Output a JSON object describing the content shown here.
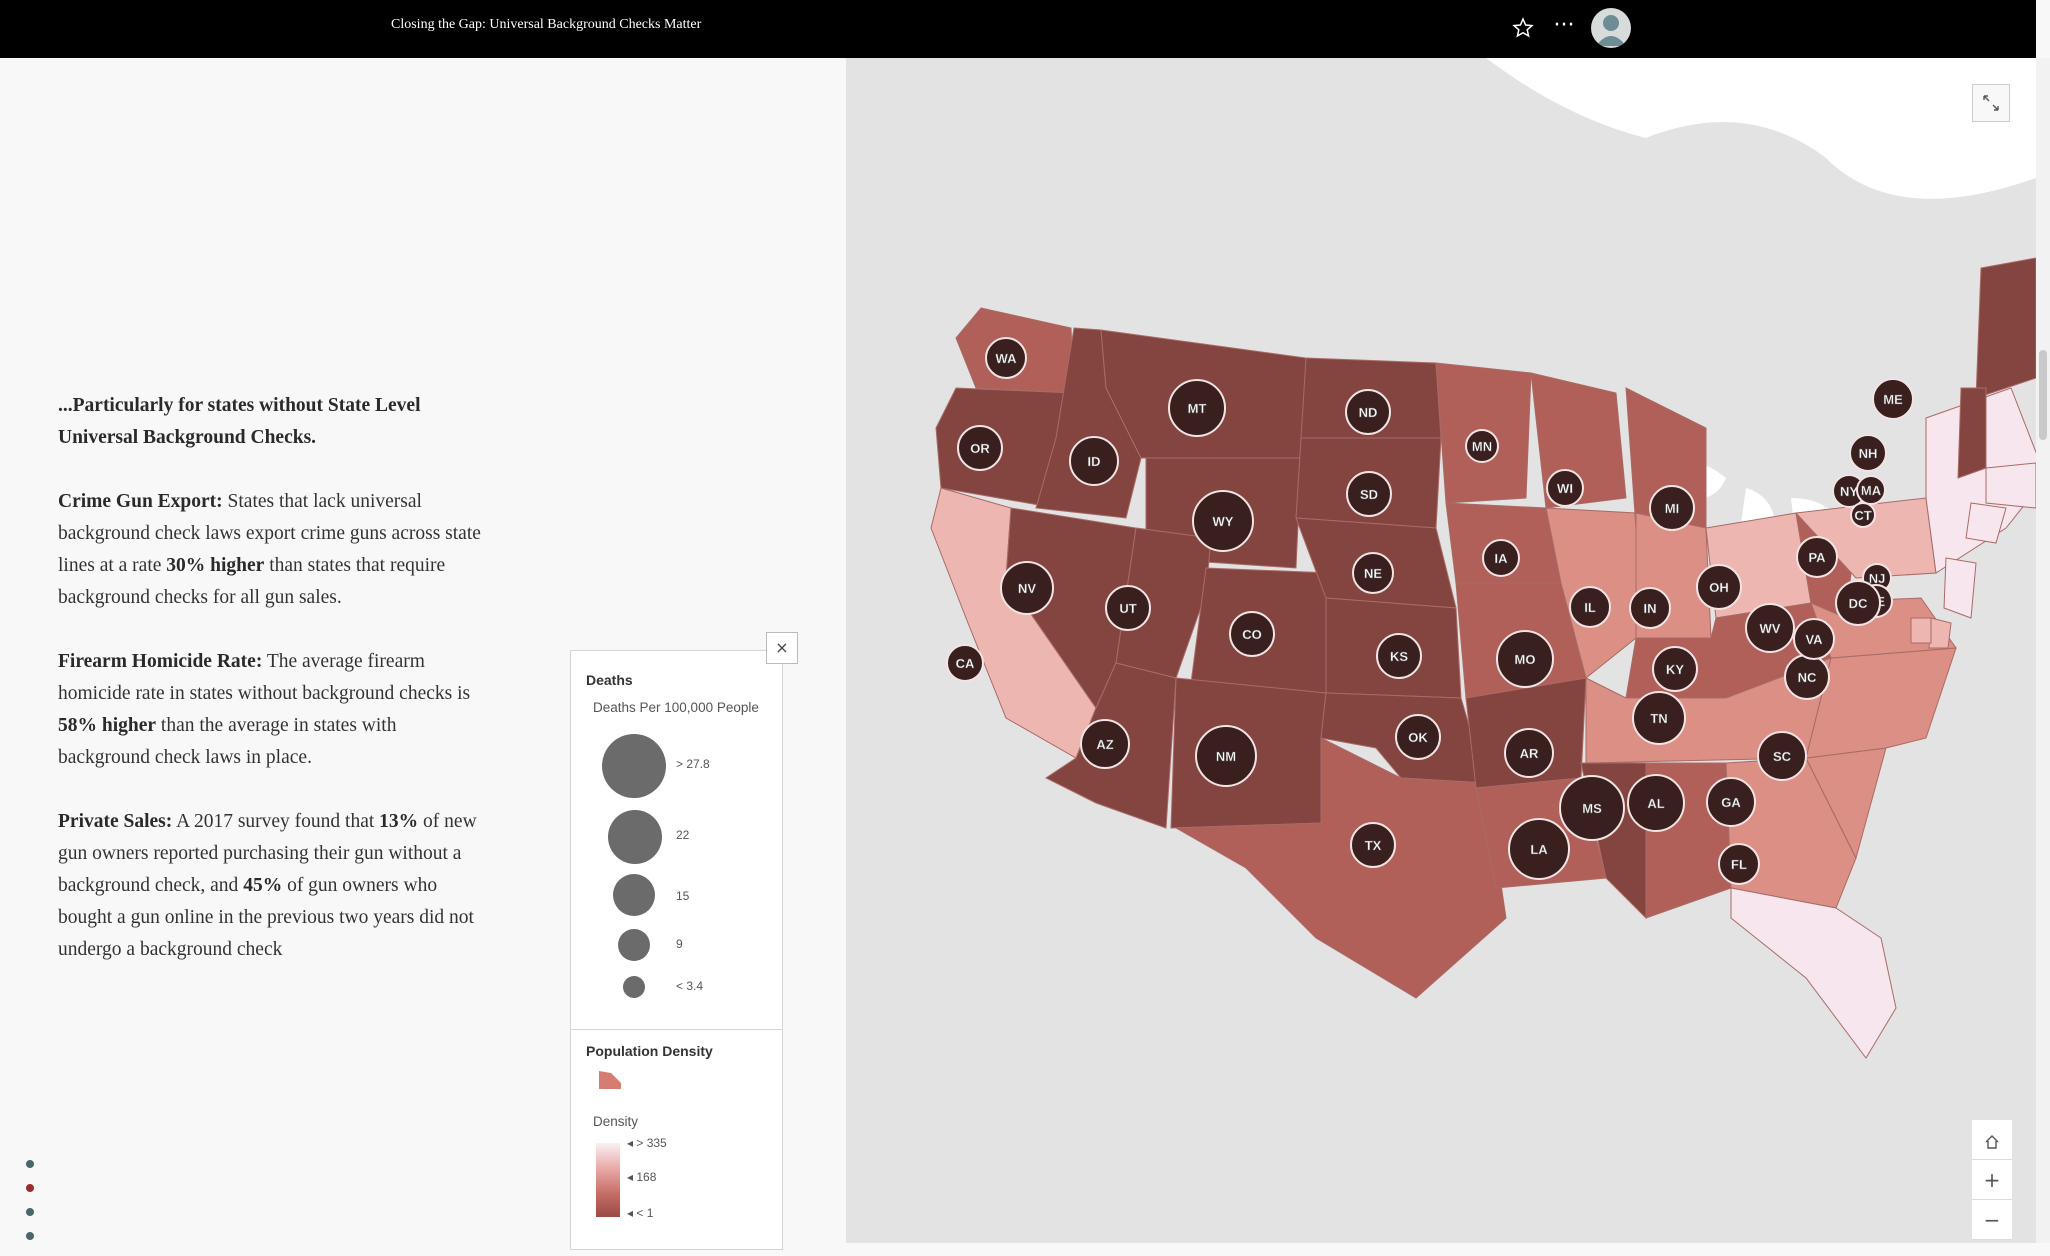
{
  "header": {
    "title": "Closing the Gap: Universal Background Checks Matter",
    "icons": [
      "star-icon",
      "more-icon",
      "avatar"
    ]
  },
  "narrative": {
    "lead": "...Particularly for states without State Level Universal Background Checks.",
    "sections": [
      {
        "heading": "Crime Gun Export:",
        "parts": [
          " States that lack universal background check laws export crime guns across state lines at a rate ",
          "30% higher",
          " than states that require background checks for all gun sales."
        ]
      },
      {
        "heading": "Firearm Homicide Rate:",
        "parts": [
          " The average firearm homicide rate in states without background checks is ",
          "58% higher",
          " than the average in states with background check laws in place."
        ]
      },
      {
        "heading": "Private Sales:",
        "parts": [
          " A 2017 survey found that ",
          "13%",
          " of new gun owners reported purchasing their gun without a background check, and ",
          "45%",
          " of gun owners who bought a gun online in the previous two years did not undergo a background check"
        ]
      }
    ]
  },
  "legend": {
    "close_label": "×",
    "deaths_title": "Deaths",
    "deaths_subtitle": "Deaths Per 100,000 People",
    "sizes": [
      {
        "label": "> 27.8"
      },
      {
        "label": "22"
      },
      {
        "label": "15"
      },
      {
        "label": "9"
      },
      {
        "label": "< 3.4"
      }
    ],
    "density_layer_title": "Population Density",
    "density_title": "Density",
    "density_labels": [
      "> 335",
      "168",
      "< 1"
    ]
  },
  "map": {
    "colors": {
      "land": "#e3e3e3",
      "water": "#ffffff",
      "dark": "#844541",
      "mid": "#b05f59",
      "light": "#db8f85",
      "pale": "#eeb6b1",
      "palest": "#f7e6ee",
      "circle": "#6b6b6b"
    },
    "states": [
      {
        "abbr": "WA",
        "tone": "mid"
      },
      {
        "abbr": "OR",
        "tone": "dark"
      },
      {
        "abbr": "CA",
        "tone": "pale"
      },
      {
        "abbr": "ID",
        "tone": "dark"
      },
      {
        "abbr": "NV",
        "tone": "dark"
      },
      {
        "abbr": "MT",
        "tone": "dark"
      },
      {
        "abbr": "WY",
        "tone": "dark"
      },
      {
        "abbr": "UT",
        "tone": "dark"
      },
      {
        "abbr": "AZ",
        "tone": "dark"
      },
      {
        "abbr": "CO",
        "tone": "dark"
      },
      {
        "abbr": "NM",
        "tone": "dark"
      },
      {
        "abbr": "ND",
        "tone": "dark"
      },
      {
        "abbr": "SD",
        "tone": "dark"
      },
      {
        "abbr": "NE",
        "tone": "dark"
      },
      {
        "abbr": "KS",
        "tone": "dark"
      },
      {
        "abbr": "OK",
        "tone": "dark"
      },
      {
        "abbr": "TX",
        "tone": "mid"
      },
      {
        "abbr": "MN",
        "tone": "mid"
      },
      {
        "abbr": "IA",
        "tone": "mid"
      },
      {
        "abbr": "MO",
        "tone": "mid"
      },
      {
        "abbr": "AR",
        "tone": "dark"
      },
      {
        "abbr": "LA",
        "tone": "mid"
      },
      {
        "abbr": "WI",
        "tone": "mid"
      },
      {
        "abbr": "IL",
        "tone": "light"
      },
      {
        "abbr": "MI",
        "tone": "mid"
      },
      {
        "abbr": "IN",
        "tone": "light"
      },
      {
        "abbr": "OH",
        "tone": "pale"
      },
      {
        "abbr": "KY",
        "tone": "mid"
      },
      {
        "abbr": "TN",
        "tone": "light"
      },
      {
        "abbr": "MS",
        "tone": "dark"
      },
      {
        "abbr": "AL",
        "tone": "mid"
      },
      {
        "abbr": "GA",
        "tone": "light"
      },
      {
        "abbr": "FL",
        "tone": "palest"
      },
      {
        "abbr": "SC",
        "tone": "light"
      },
      {
        "abbr": "NC",
        "tone": "light"
      },
      {
        "abbr": "VA",
        "tone": "light"
      },
      {
        "abbr": "WV",
        "tone": "mid"
      },
      {
        "abbr": "PA",
        "tone": "pale"
      },
      {
        "abbr": "NY",
        "tone": "palest"
      },
      {
        "abbr": "ME",
        "tone": "dark"
      },
      {
        "abbr": "NH",
        "tone": "dark"
      },
      {
        "abbr": "MA",
        "tone": "palest"
      },
      {
        "abbr": "CT",
        "tone": "palest"
      },
      {
        "abbr": "NJ",
        "tone": "palest"
      },
      {
        "abbr": "DE",
        "tone": "pale"
      },
      {
        "abbr": "DC",
        "tone": "pale"
      }
    ]
  }
}
